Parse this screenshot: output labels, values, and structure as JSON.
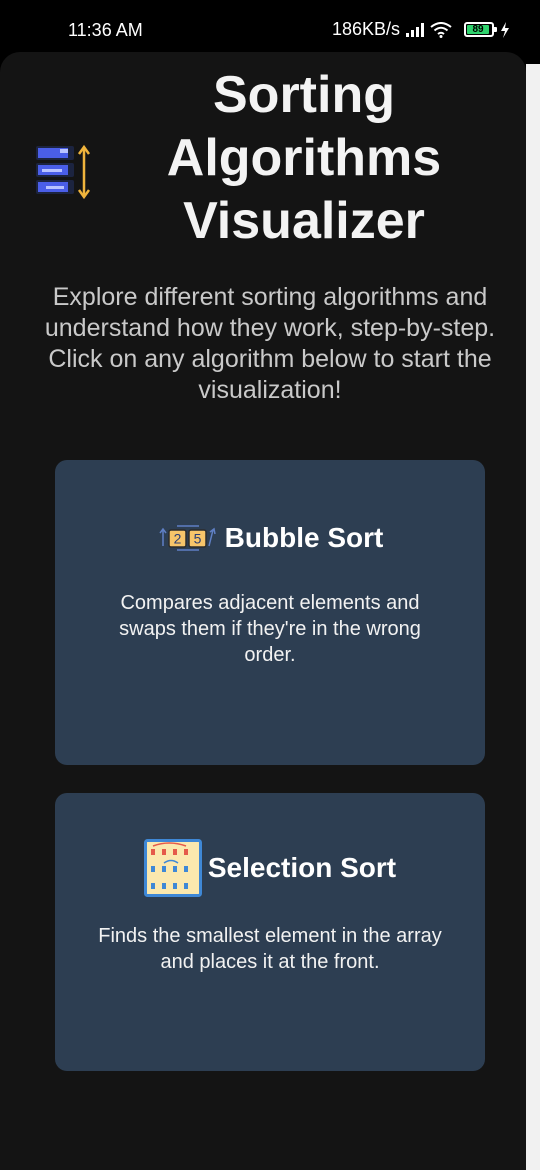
{
  "status_bar": {
    "time": "11:36 AM",
    "network_speed": "186KB/s",
    "battery_level": "89"
  },
  "header": {
    "title": "Sorting Algorithms Visualizer",
    "intro": "Explore different sorting algorithms and understand how they work, step-by-step. Click on any algorithm below to start the visualization!"
  },
  "algorithms": [
    {
      "name": "Bubble Sort",
      "description": "Compares adjacent elements and swaps them if they're in the wrong order.",
      "icon": "bubble-sort-icon",
      "icon_digits": [
        "2",
        "5"
      ]
    },
    {
      "name": "Selection Sort",
      "description": "Finds the smallest element in the array and places it at the front.",
      "icon": "selection-sort-icon"
    }
  ],
  "colors": {
    "background": "#141414",
    "card": "#2d3e52",
    "accent": "#f0b43c",
    "logo_blue": "#4a5ee8"
  }
}
